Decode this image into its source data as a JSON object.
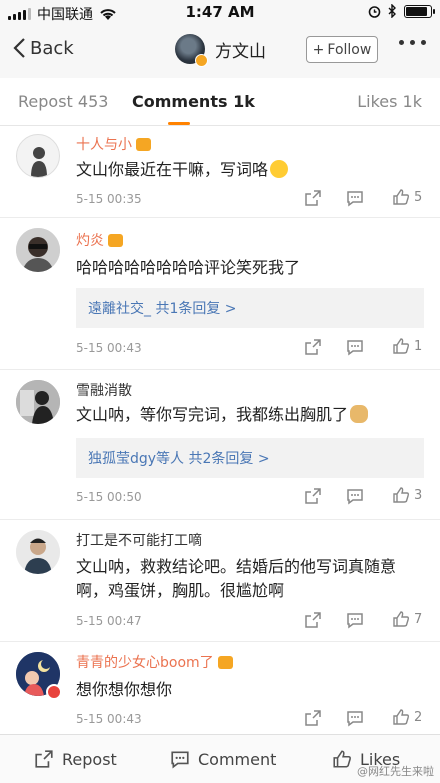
{
  "status_bar": {
    "carrier": "中国联通",
    "time": "1:47 AM",
    "battery_level": 0.9
  },
  "nav": {
    "back_label": "Back",
    "user_name": "方文山",
    "follow_label": "Follow"
  },
  "tabs": [
    {
      "label": "Repost 453"
    },
    {
      "label": "Comments 1k"
    },
    {
      "label": "Likes 1k"
    }
  ],
  "comments": [
    {
      "user": "十人与小",
      "text": "文山你最近在干嘛，写词咯",
      "time": "5-15 00:35",
      "likes": "5"
    },
    {
      "user": "灼炎",
      "text": "哈哈哈哈哈哈哈哈评论笑死我了",
      "reply": "遠離社交_  共1条回复 >",
      "time": "5-15 00:43",
      "likes": "1"
    },
    {
      "user": "雪融消散",
      "text": "文山呐，等你写完词，我都练出胸肌了",
      "reply": "独孤莹dgy等人  共2条回复 >",
      "time": "5-15 00:50",
      "likes": "3"
    },
    {
      "user": "打工是不可能打工嘀",
      "text": "文山呐，救救结论吧。结婚后的他写词真随意啊，鸡蛋饼，胸肌。很尴尬啊",
      "time": "5-15 00:47",
      "likes": "7"
    },
    {
      "user": "青青的少女心boom了",
      "text": "想你想你想你",
      "time": "5-15 00:43",
      "likes": "2"
    }
  ],
  "bottom_bar": {
    "repost_label": "Repost",
    "comment_label": "Comment",
    "likes_label": "Likes"
  },
  "watermark": "@网红先生来啦",
  "colors": {
    "accent": "#ff8200",
    "username_orange": "#eb7350",
    "link_blue": "#4a77b5"
  }
}
